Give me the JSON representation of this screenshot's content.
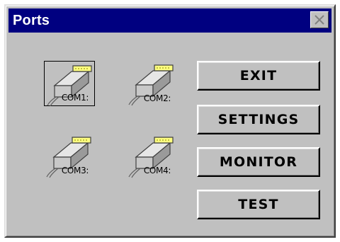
{
  "window": {
    "title": "Ports"
  },
  "ports": [
    {
      "label": "COM1:",
      "selected": true
    },
    {
      "label": "COM2:",
      "selected": false
    },
    {
      "label": "COM3:",
      "selected": false
    },
    {
      "label": "COM4:",
      "selected": false
    }
  ],
  "buttons": {
    "exit": "EXIT",
    "settings": "SETTINGS",
    "monitor": "MONITOR",
    "test": "TEST"
  },
  "icons": {
    "close": "close-icon",
    "port": "serial-port-icon"
  },
  "colors": {
    "titlebar": "#000080",
    "face": "#c0c0c0",
    "connector": "#ffff80"
  }
}
